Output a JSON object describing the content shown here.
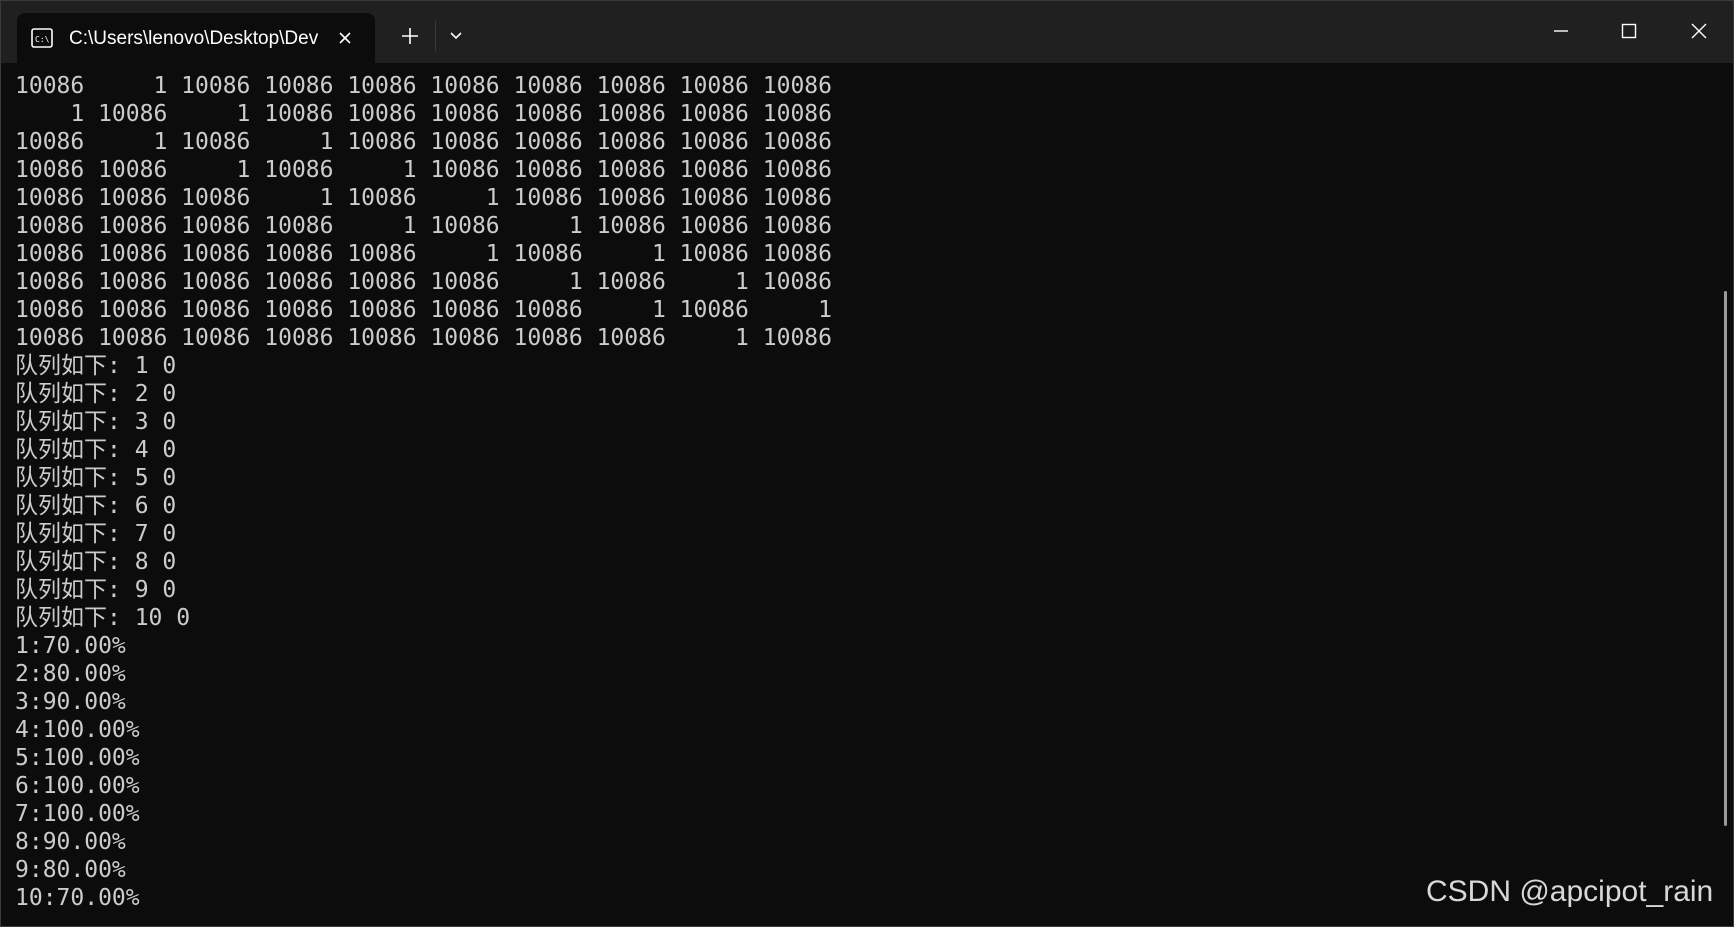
{
  "window": {
    "tab_title": "C:\\Users\\lenovo\\Desktop\\Dev",
    "tab_icon": "console-icon",
    "new_tab_label": "+",
    "dropdown_icon": "chevron-down-icon"
  },
  "console": {
    "lines": [
      "10086     1 10086 10086 10086 10086 10086 10086 10086 10086",
      "    1 10086     1 10086 10086 10086 10086 10086 10086 10086",
      "10086     1 10086     1 10086 10086 10086 10086 10086 10086",
      "10086 10086     1 10086     1 10086 10086 10086 10086 10086",
      "10086 10086 10086     1 10086     1 10086 10086 10086 10086",
      "10086 10086 10086 10086     1 10086     1 10086 10086 10086",
      "10086 10086 10086 10086 10086     1 10086     1 10086 10086",
      "10086 10086 10086 10086 10086 10086     1 10086     1 10086",
      "10086 10086 10086 10086 10086 10086 10086     1 10086     1",
      "10086 10086 10086 10086 10086 10086 10086 10086     1 10086",
      "队列如下: 1 0",
      "队列如下: 2 0",
      "队列如下: 3 0",
      "队列如下: 4 0",
      "队列如下: 5 0",
      "队列如下: 6 0",
      "队列如下: 7 0",
      "队列如下: 8 0",
      "队列如下: 9 0",
      "队列如下: 10 0",
      "1:70.00%",
      "2:80.00%",
      "3:90.00%",
      "4:100.00%",
      "5:100.00%",
      "6:100.00%",
      "7:100.00%",
      "8:90.00%",
      "9:80.00%",
      "10:70.00%"
    ]
  },
  "watermark": "CSDN @apcipot_rain",
  "colors": {
    "console_bg": "#0c0c0c",
    "console_text": "#cccccc",
    "titlebar_bg": "#202020"
  }
}
